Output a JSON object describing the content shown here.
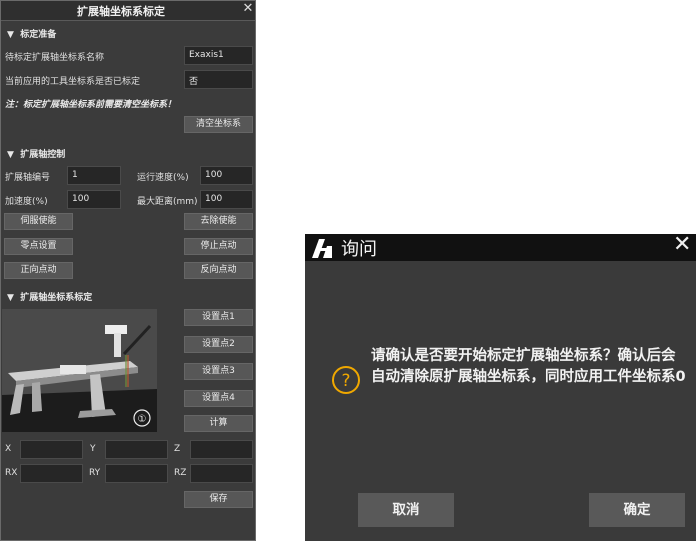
{
  "panel": {
    "title": "扩展轴坐标系标定",
    "close_glyph": "✕",
    "section1": {
      "title": "标定准备",
      "name_label": "待标定扩展轴坐标系名称",
      "name_value": "Exaxis1",
      "tool_label": "当前应用的工具坐标系是否已标定",
      "tool_value": "否",
      "note": "注：标定扩展轴坐标系前需要清空坐标系！",
      "clear_button": "清空坐标系"
    },
    "section2": {
      "title": "扩展轴控制",
      "axis_no_label": "扩展轴编号",
      "axis_no_value": "1",
      "speed_label": "运行速度(%)",
      "speed_value": "100",
      "acc_label": "加速度(%)",
      "acc_value": "100",
      "maxdist_label": "最大距离(mm)",
      "maxdist_value": "100",
      "servo_enable": "伺服使能",
      "servo_disable": "去除使能",
      "zero_set": "零点设置",
      "stop_jog": "停止点动",
      "forward_jog": "正向点动",
      "reverse_jog": "反向点动"
    },
    "section3": {
      "title": "扩展轴坐标系标定",
      "set_p1": "设置点1",
      "set_p2": "设置点2",
      "set_p3": "设置点3",
      "set_p4": "设置点4",
      "compute": "计算",
      "image_badge": "①",
      "x": "X",
      "y": "Y",
      "z": "Z",
      "rx": "RX",
      "ry": "RY",
      "rz": "RZ",
      "save": "保存"
    }
  },
  "dialog": {
    "title": "询问",
    "message": "请确认是否要开始标定扩展轴坐标系？确认后会自动清除原扩展轴坐标系，同时应用工件坐标系0",
    "cancel": "取消",
    "ok": "确定",
    "question_mark": "?"
  },
  "colors": {
    "panel_bg": "#3b3b3b",
    "field_bg": "#262626",
    "button_bg": "#575757",
    "dialog_title_bg": "#111111",
    "question_accent": "#f0a800"
  }
}
